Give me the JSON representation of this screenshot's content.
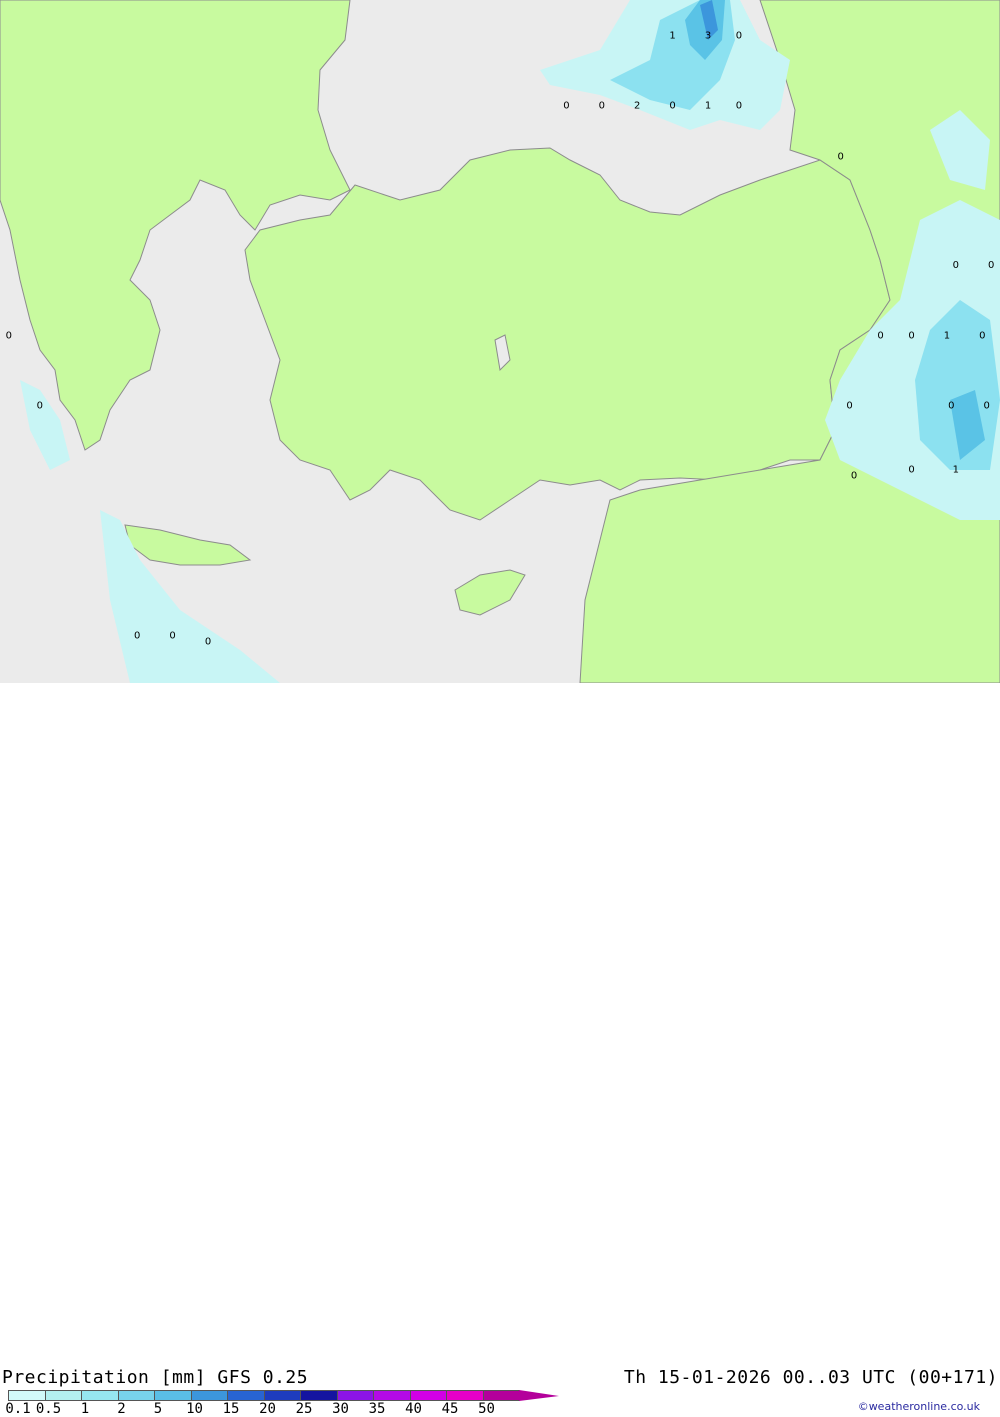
{
  "footer": {
    "title": "Precipitation [mm] GFS 0.25",
    "datetime": "Th 15-01-2026 00..03 UTC (00+171)",
    "credit": "©weatheronline.co.uk"
  },
  "legend": {
    "labels": [
      "0.1",
      "0.5",
      "1",
      "2",
      "5",
      "10",
      "15",
      "20",
      "25",
      "30",
      "35",
      "40",
      "45",
      "50"
    ],
    "colors": [
      "#d2fafa",
      "#b4f0f0",
      "#96e6f0",
      "#78d2eb",
      "#5abee6",
      "#3c96dc",
      "#2864d2",
      "#1e3cbe",
      "#1414a0",
      "#8c14e6",
      "#b40ae6",
      "#d200e6",
      "#e600c8",
      "#b4009b"
    ]
  },
  "map": {
    "colors": {
      "sea": "#ebebeb",
      "land": "#c8fa9f",
      "precip_light": "#c8f5f5",
      "precip_mid": "#8ce1f0",
      "precip_high": "#5ac3e6",
      "precip_max": "#3c96dc",
      "border": "#8c8c8c"
    },
    "values": [
      {
        "text": "1",
        "lon": 31.2,
        "lat": 44.6
      },
      {
        "text": "3",
        "lon": 32.0,
        "lat": 44.6
      },
      {
        "text": "0",
        "lon": 32.7,
        "lat": 44.6
      },
      {
        "text": "0",
        "lon": 28.8,
        "lat": 43.5
      },
      {
        "text": "0",
        "lon": 29.6,
        "lat": 43.5
      },
      {
        "text": "2",
        "lon": 30.4,
        "lat": 43.5
      },
      {
        "text": "0",
        "lon": 31.2,
        "lat": 43.5
      },
      {
        "text": "1",
        "lon": 32.0,
        "lat": 43.5
      },
      {
        "text": "0",
        "lon": 32.7,
        "lat": 43.5
      },
      {
        "text": "0",
        "lon": 35.0,
        "lat": 42.7
      },
      {
        "text": "0",
        "lon": 37.6,
        "lat": 41.0
      },
      {
        "text": "0",
        "lon": 38.4,
        "lat": 41.0
      },
      {
        "text": "0",
        "lon": 35.9,
        "lat": 39.9
      },
      {
        "text": "0",
        "lon": 36.6,
        "lat": 39.9
      },
      {
        "text": "1",
        "lon": 37.4,
        "lat": 39.9
      },
      {
        "text": "0",
        "lon": 38.2,
        "lat": 39.9
      },
      {
        "text": "0",
        "lon": 35.2,
        "lat": 38.8
      },
      {
        "text": "0",
        "lon": 37.5,
        "lat": 38.8
      },
      {
        "text": "0",
        "lon": 38.3,
        "lat": 38.8
      },
      {
        "text": "1",
        "lon": 37.6,
        "lat": 37.8
      },
      {
        "text": "0",
        "lon": 36.6,
        "lat": 37.8
      },
      {
        "text": "0",
        "lon": 35.3,
        "lat": 37.7
      },
      {
        "text": "0",
        "lon": 16.2,
        "lat": 39.9
      },
      {
        "text": "0",
        "lon": 16.9,
        "lat": 38.8
      },
      {
        "text": "0",
        "lon": 19.1,
        "lat": 35.2
      },
      {
        "text": "0",
        "lon": 19.9,
        "lat": 35.2
      },
      {
        "text": "0",
        "lon": 20.7,
        "lat": 35.1
      }
    ]
  }
}
